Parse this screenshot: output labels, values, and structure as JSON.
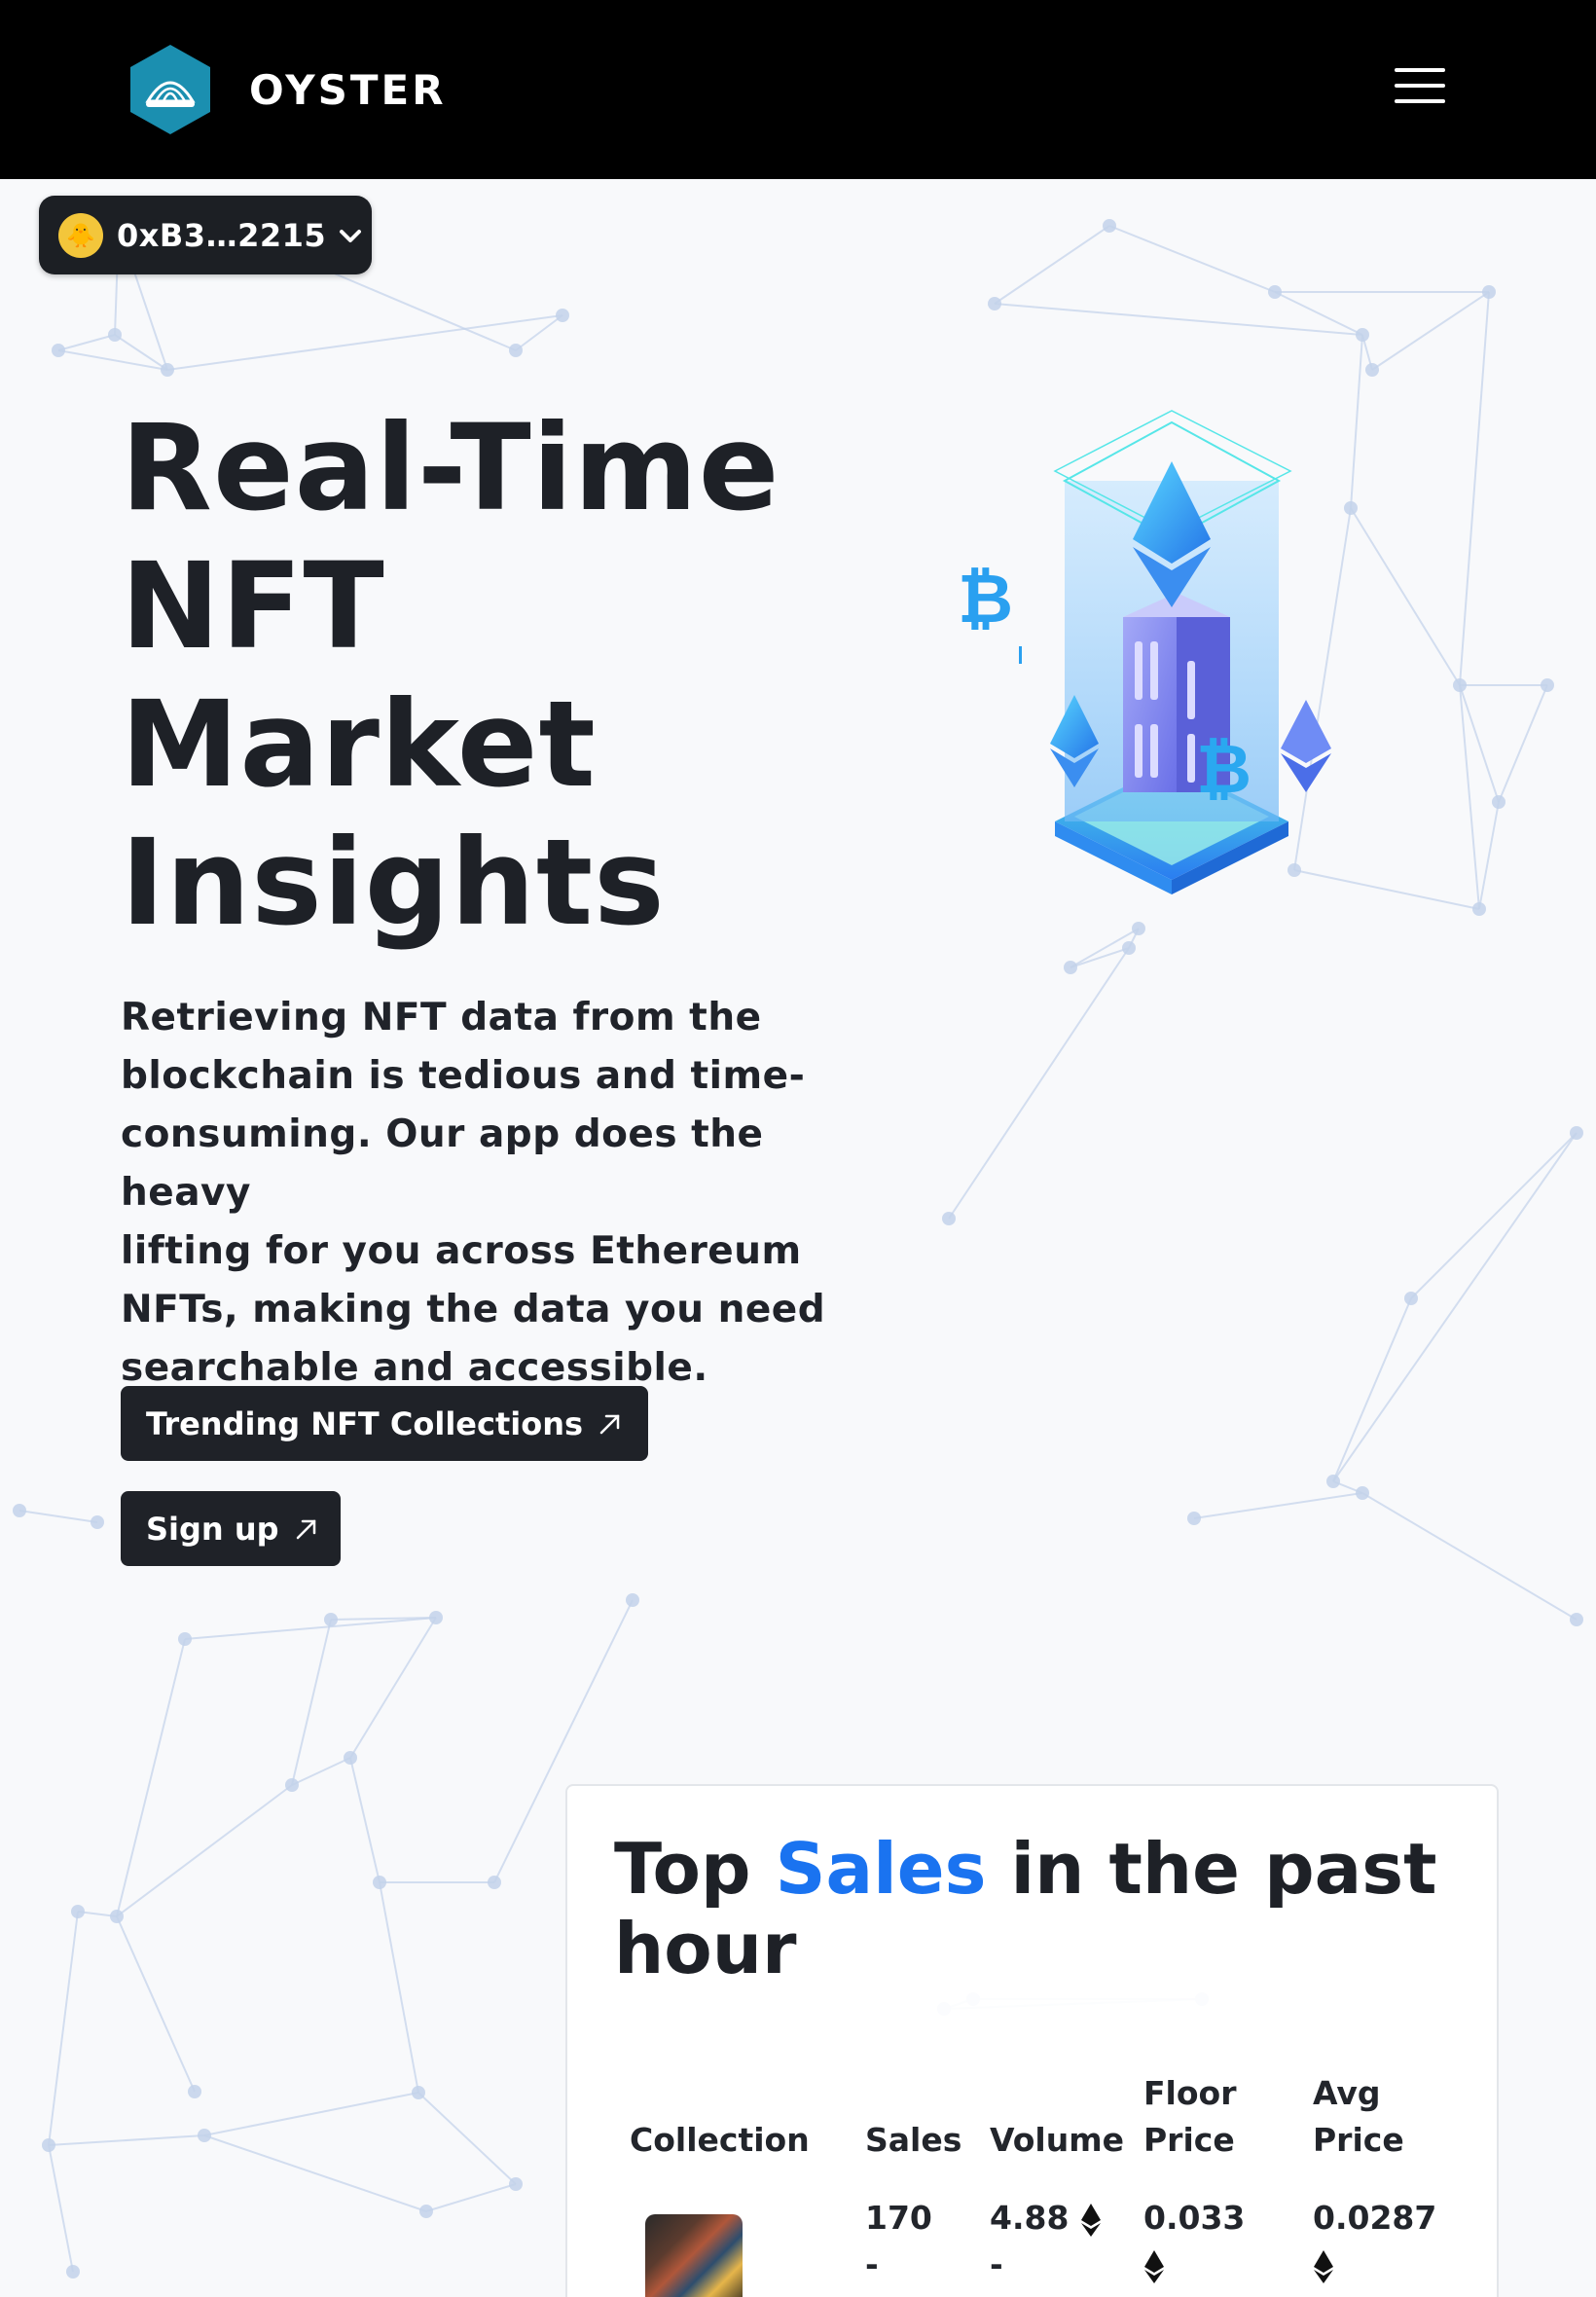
{
  "header": {
    "brand_name": "OYSTER",
    "logo_icon": "oyster-logo-icon",
    "menu_icon": "hamburger-menu-icon"
  },
  "wallet": {
    "address": "0xB3…2215",
    "avatar_icon": "duck-avatar-icon",
    "chevron_icon": "chevron-down-icon"
  },
  "hero": {
    "title_lines": [
      "Real-Time",
      "NFT",
      "Market",
      "Insights"
    ],
    "description_lines": [
      "Retrieving NFT data from the",
      "blockchain is tedious and time-",
      "consuming. Our app does the heavy",
      "lifting for you across Ethereum",
      "NFTs, making the data you need",
      "searchable and accessible."
    ],
    "btn_trending": "Trending NFT Collections",
    "btn_signup": "Sign up",
    "illustration_icon": "crypto-server-illustration"
  },
  "sales": {
    "title_pre": "Top ",
    "title_accent": "Sales",
    "title_post": " in the past",
    "title_line2": "hour",
    "accent_color": "#1a73f0",
    "columns": {
      "collection": "Collection",
      "sales": "Sales",
      "volume": "Volume",
      "floor_1": "Floor",
      "floor_2": "Price",
      "avg_1": "Avg",
      "avg_2": "Price"
    },
    "row": {
      "sales": "170",
      "sales_dash": "-",
      "volume": "4.88",
      "volume_dash": "-",
      "floor": "0.033",
      "avg": "0.0287"
    }
  }
}
